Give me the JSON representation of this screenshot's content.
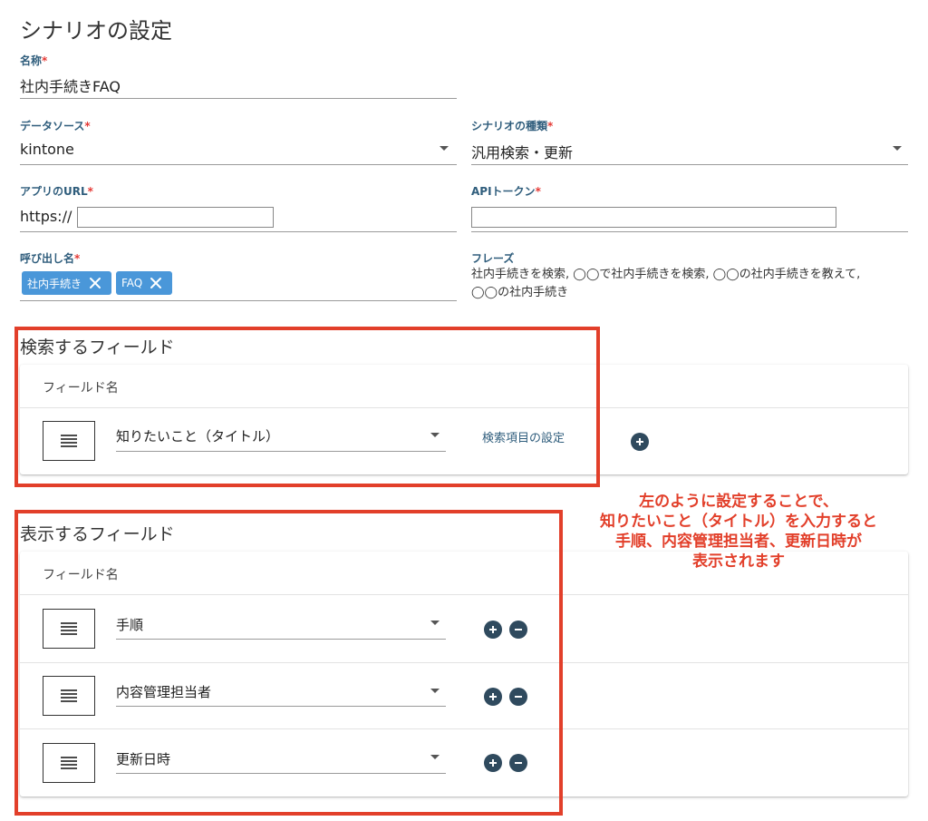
{
  "page": {
    "title": "シナリオの設定"
  },
  "form": {
    "name": {
      "label": "名称",
      "value": "社内手続きFAQ"
    },
    "datasource": {
      "label": "データソース",
      "value": "kintone"
    },
    "scenario_type": {
      "label": "シナリオの種類",
      "value": "汎用検索・更新"
    },
    "app_url": {
      "label": "アプリのURL",
      "prefix": "https://",
      "value": ""
    },
    "api_token": {
      "label": "APIトークン",
      "value": ""
    },
    "call_name": {
      "label": "呼び出し名",
      "chips": [
        {
          "label": "社内手続き"
        },
        {
          "label": "FAQ"
        }
      ]
    },
    "phrase": {
      "label": "フレーズ",
      "line1": "社内手続きを検索, ◯◯で社内手続きを検索, ◯◯の社内手続きを教えて,",
      "line2": "◯◯の社内手続き"
    },
    "required_mark": "*"
  },
  "search_section": {
    "title": "検索するフィールド",
    "header": "フィールド名",
    "rows": [
      {
        "field": "知りたいこと（タイトル）",
        "link": "検索項目の設定"
      }
    ]
  },
  "display_section": {
    "title": "表示するフィールド",
    "header": "フィールド名",
    "rows": [
      {
        "field": "手順"
      },
      {
        "field": "内容管理担当者"
      },
      {
        "field": "更新日時"
      }
    ]
  },
  "annotation": {
    "line1": "左のように設定することで、",
    "line2": "知りたいこと（タイトル）を入力すると",
    "line3": "手順、内容管理担当者、更新日時が",
    "line4": "表示されます"
  },
  "colors": {
    "label": "#2f5d7c",
    "chip": "#4a97d9",
    "icon_button": "#2f4a5e",
    "highlight": "#e23f2a"
  },
  "icons": {
    "chip_remove": "close-icon",
    "handle": "drag-handle-icon",
    "add": "plus-circle-icon",
    "remove": "minus-circle-icon",
    "dropdown": "caret-down-icon"
  }
}
